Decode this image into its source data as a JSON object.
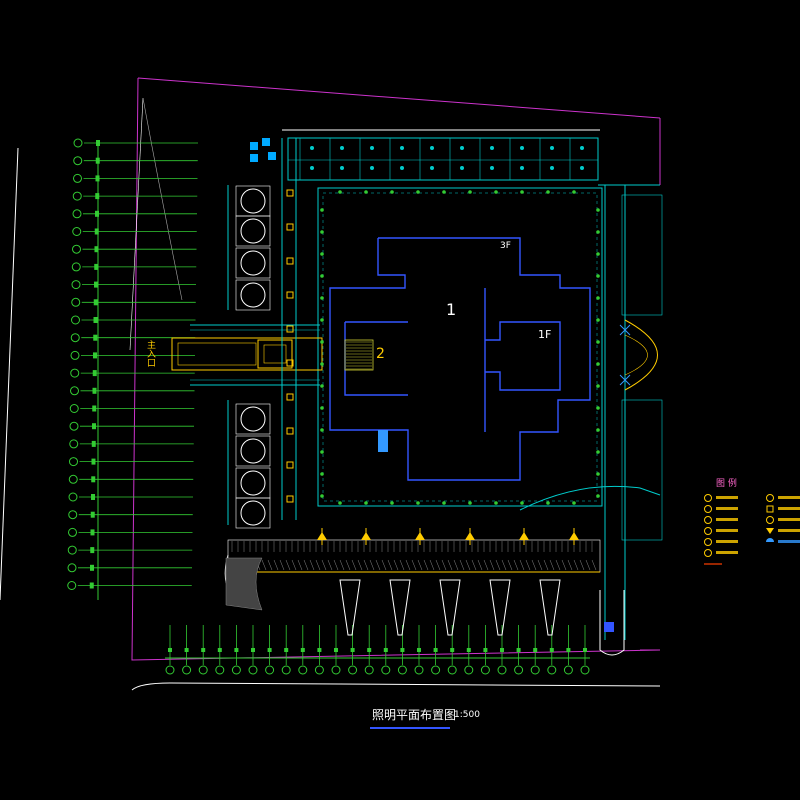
{
  "drawing": {
    "title": "照明平面布置图",
    "scale": "1:500"
  },
  "site_labels": {
    "building_1": "1",
    "building_2": "2",
    "building_3f": "3F",
    "building_1f": "1F",
    "entrance": "入口",
    "main_entry_left": "主入口"
  },
  "legend": {
    "title": "图 例",
    "items": [
      {
        "symbol": "circle-star",
        "color": "#ffcc00"
      },
      {
        "symbol": "circle-star",
        "color": "#ffcc00"
      },
      {
        "symbol": "circle-star",
        "color": "#ffcc00"
      },
      {
        "symbol": "circle-star",
        "color": "#ffcc00"
      },
      {
        "symbol": "circle-star",
        "color": "#ffcc00"
      },
      {
        "symbol": "diamond",
        "color": "#ffcc00"
      },
      {
        "symbol": "circle-dot",
        "color": "#ffcc00"
      },
      {
        "symbol": "box-cross",
        "color": "#ffcc00"
      },
      {
        "symbol": "star",
        "color": "#ffcc00"
      },
      {
        "symbol": "triangle",
        "color": "#ffcc00"
      },
      {
        "symbol": "half-circle",
        "color": "#3399ff"
      }
    ],
    "line_item_color": "#cc3300"
  },
  "colors": {
    "background": "#000000",
    "green_line": "#33cc33",
    "cyan_line": "#00cccc",
    "blue_line": "#3355ff",
    "magenta_line": "#cc33cc",
    "white_line": "#ffffff",
    "yellow": "#ffcc00"
  },
  "left_column_count": 26,
  "bottom_row_count": 26
}
